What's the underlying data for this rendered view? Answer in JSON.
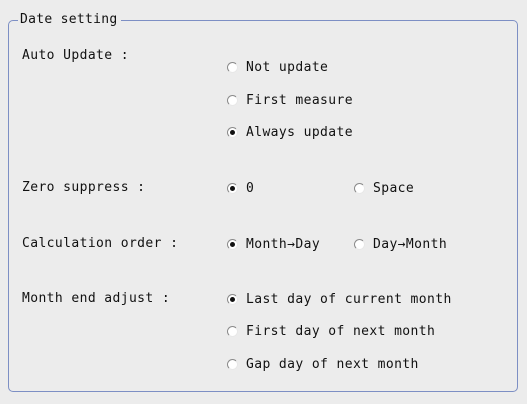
{
  "group": {
    "title": "Date setting"
  },
  "auto_update": {
    "label": "Auto Update :",
    "options": [
      {
        "label": "Not update",
        "checked": false
      },
      {
        "label": "First measure",
        "checked": false
      },
      {
        "label": "Always update",
        "checked": true
      }
    ]
  },
  "zero_suppress": {
    "label": "Zero suppress :",
    "options": [
      {
        "label": "0",
        "checked": true
      },
      {
        "label": "Space",
        "checked": false
      }
    ]
  },
  "calculation_order": {
    "label": "Calculation order :",
    "options": [
      {
        "label": "Month→Day",
        "checked": true
      },
      {
        "label": "Day→Month",
        "checked": false
      }
    ]
  },
  "month_end_adjust": {
    "label": "Month end adjust :",
    "options": [
      {
        "label": "Last day of current month",
        "checked": true
      },
      {
        "label": "First day of next month",
        "checked": false
      },
      {
        "label": "Gap day of next month",
        "checked": false
      }
    ]
  }
}
